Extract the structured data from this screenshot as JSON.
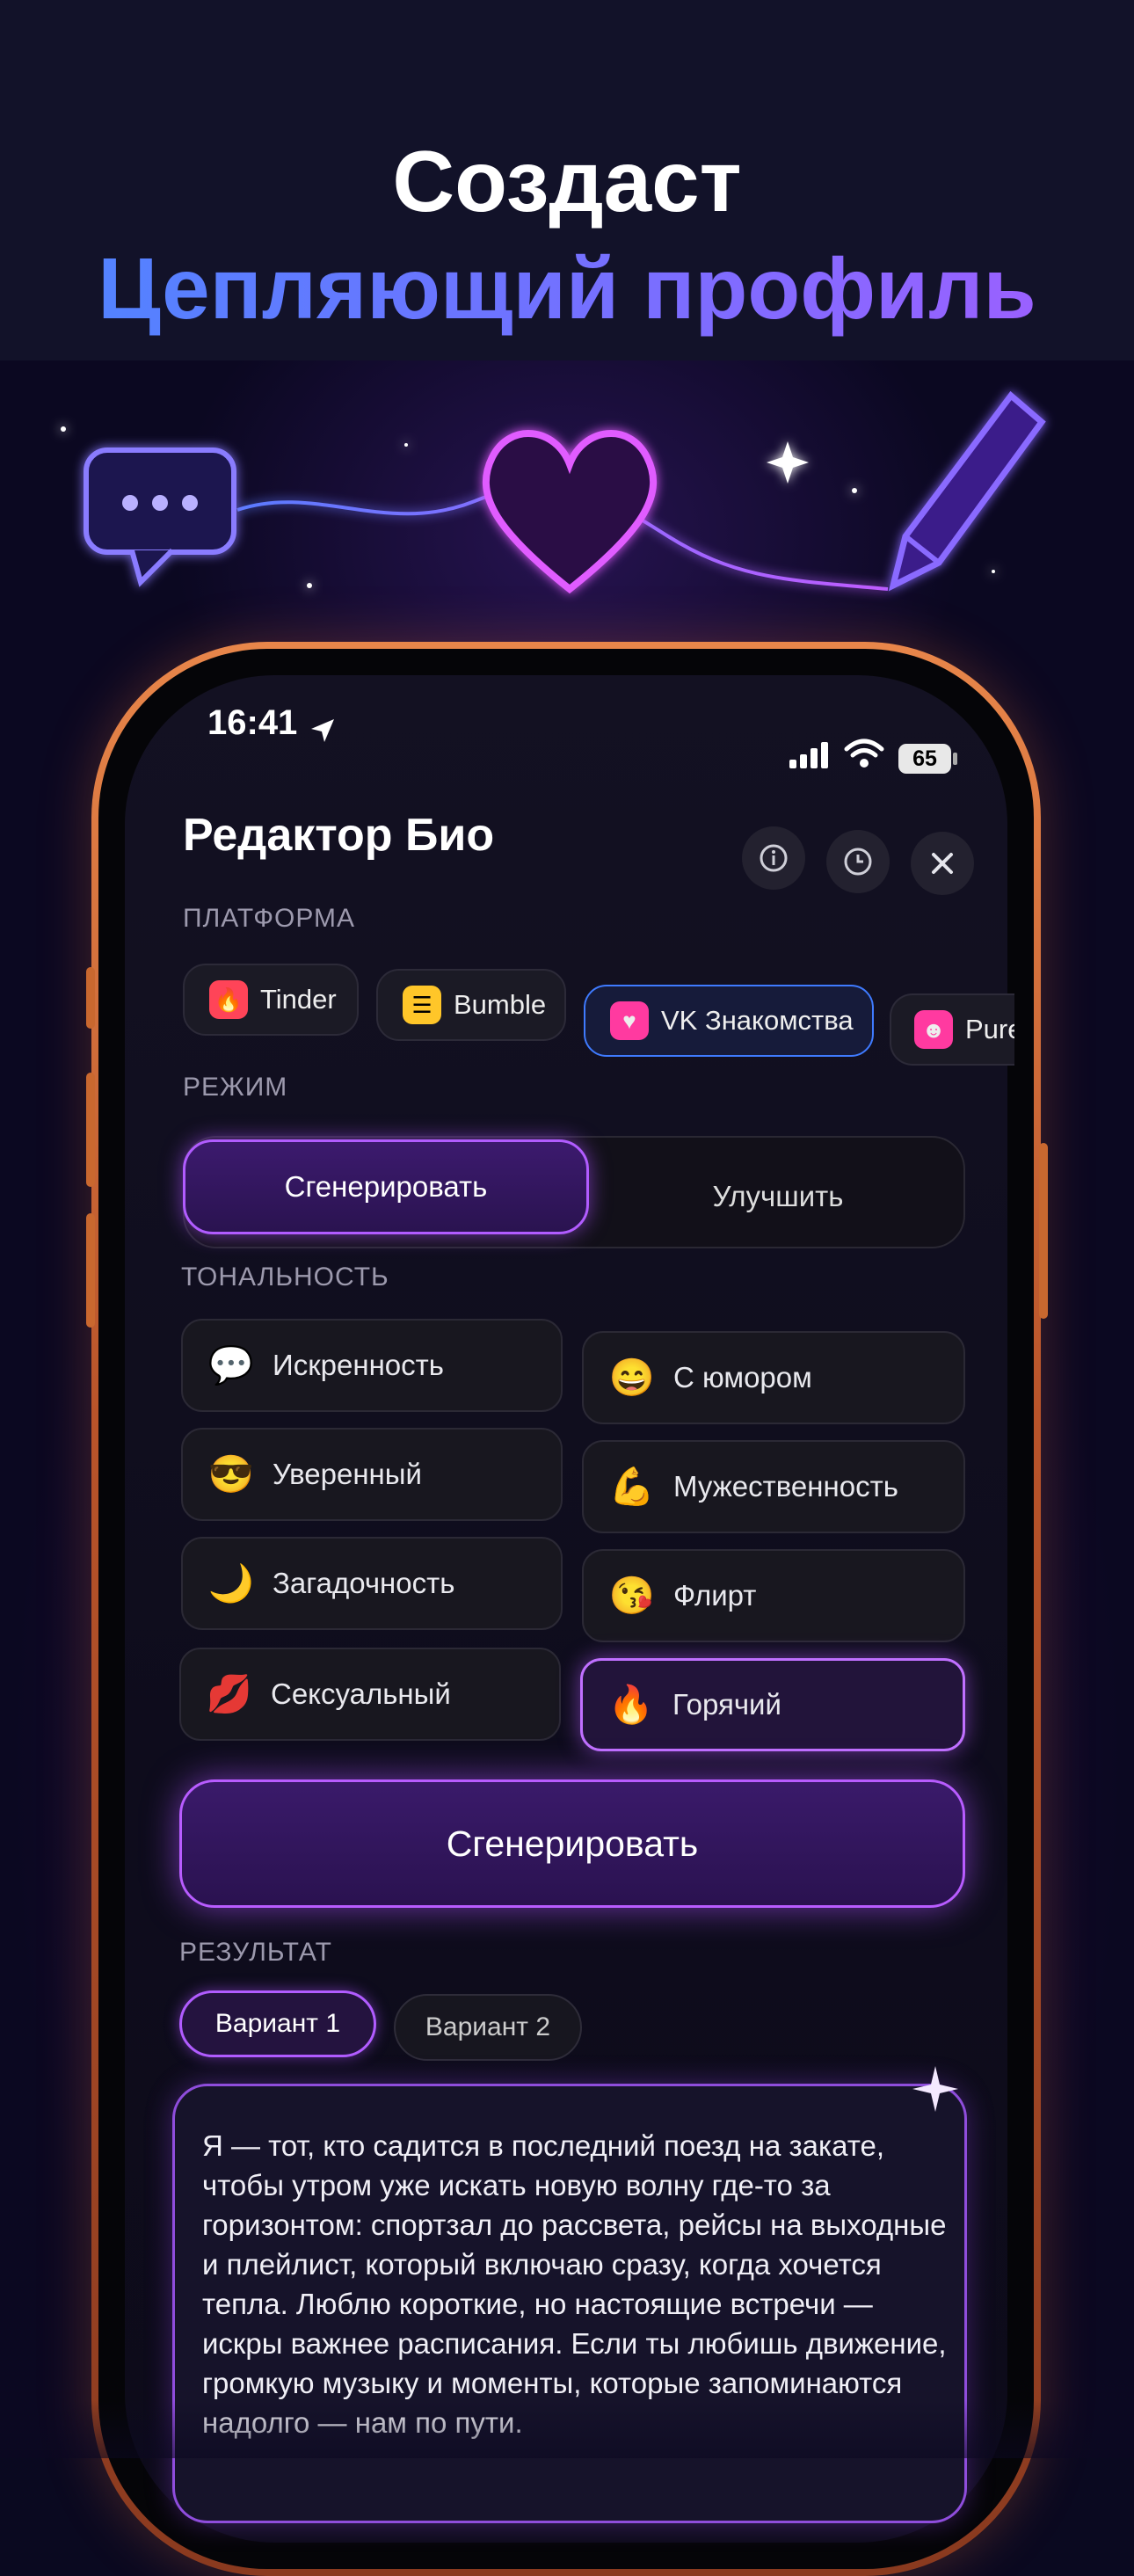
{
  "headline": {
    "line1": "Создаст",
    "line2": "Цепляющий профиль"
  },
  "decor": {
    "icons": [
      "chat-bubble-icon",
      "heart-icon",
      "pencil-icon",
      "sparkle-icon"
    ]
  },
  "status_bar": {
    "time": "16:41",
    "battery": "65"
  },
  "app": {
    "title": "Редактор Био",
    "header_icons": [
      "info-icon",
      "history-icon",
      "close-icon"
    ],
    "platform_label": "ПЛАТФОРМА",
    "platforms": [
      {
        "label": "Tinder",
        "icon": "tinder-icon",
        "color": "#ff4458",
        "selected": false
      },
      {
        "label": "Bumble",
        "icon": "bumble-icon",
        "color": "#ffc629",
        "selected": false
      },
      {
        "label": "VK Знакомства",
        "icon": "vk-dating-icon",
        "color": "#ff3aa0",
        "selected": true
      },
      {
        "label": "Pure",
        "icon": "pure-icon",
        "color": "#ff3aa0",
        "selected": false
      }
    ],
    "mode_label": "РЕЖИМ",
    "modes": {
      "generate": "Сгенерировать",
      "improve": "Улучшить",
      "active": "generate"
    },
    "tone_label": "ТОНАЛЬНОСТЬ",
    "tones": [
      {
        "emoji": "💬",
        "label": "Искренность",
        "active": false
      },
      {
        "emoji": "😄",
        "label": "С юмором",
        "active": false
      },
      {
        "emoji": "😎",
        "label": "Уверенный",
        "active": false
      },
      {
        "emoji": "💪",
        "label": "Мужественность",
        "active": false
      },
      {
        "emoji": "🌙",
        "label": "Загадочность",
        "active": false
      },
      {
        "emoji": "😘",
        "label": "Флирт",
        "active": false
      },
      {
        "emoji": "💋",
        "label": "Сексуальный",
        "active": false
      },
      {
        "emoji": "🔥",
        "label": "Горячий",
        "active": true
      }
    ],
    "generate_button": "Сгенерировать",
    "result_label": "РЕЗУЛЬТАТ",
    "variants": [
      {
        "label": "Вариант 1",
        "active": true
      },
      {
        "label": "Вариант 2",
        "active": false
      }
    ],
    "result_text": "Я — тот, кто садится в последний поезд на закате, чтобы утром уже искать новую волну где-то за горизонтом: спортзал до рассвета, рейсы на выходные и плейлист, который включаю сразу, когда хочется тепла. Люблю короткие, но настоящие встречи — искры важнее расписания. Если ты любишь движение, громкую музыку и моменты, которые запоминаются надолго — нам по пути."
  },
  "colors": {
    "accent_purple": "#b15cff",
    "accent_blue": "#3f7bff",
    "frame_orange": "#e8864a"
  }
}
